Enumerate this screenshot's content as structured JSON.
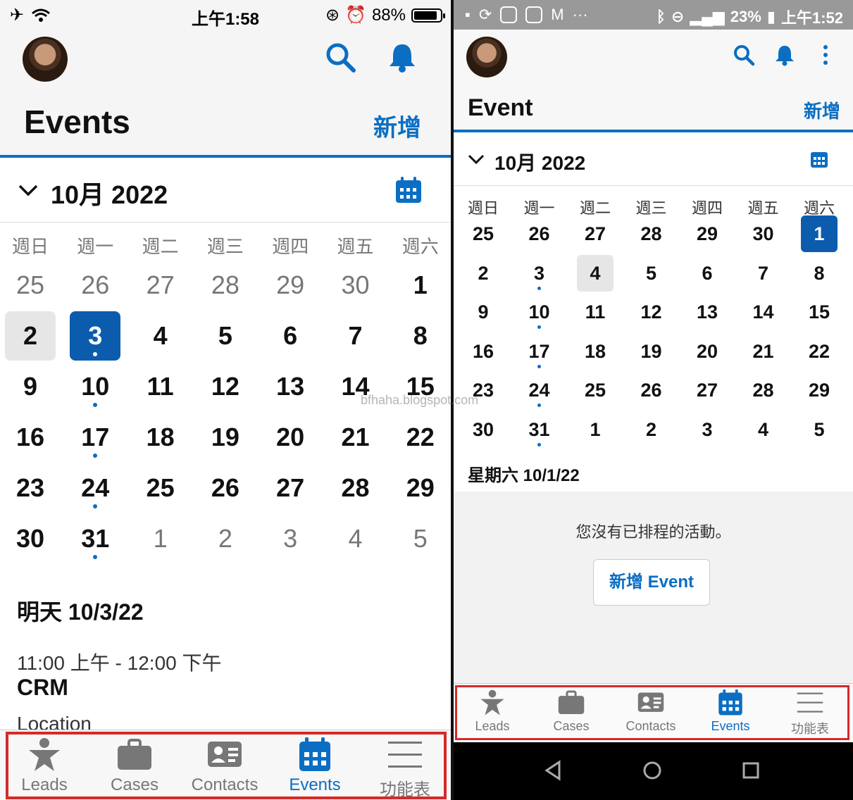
{
  "left": {
    "status": {
      "time": "上午1:58",
      "battery": "88%",
      "battery_level": 0.88
    },
    "title": "Events",
    "new_button": "新增",
    "month_label": "10月 2022",
    "weekdays": [
      "週日",
      "週一",
      "週二",
      "週三",
      "週四",
      "週五",
      "週六"
    ],
    "weeks": [
      [
        {
          "d": "25",
          "o": true
        },
        {
          "d": "26",
          "o": true
        },
        {
          "d": "27",
          "o": true
        },
        {
          "d": "28",
          "o": true
        },
        {
          "d": "29",
          "o": true
        },
        {
          "d": "30",
          "o": true
        },
        {
          "d": "1"
        }
      ],
      [
        {
          "d": "2",
          "today": true
        },
        {
          "d": "3",
          "sel": true,
          "dot": true
        },
        {
          "d": "4"
        },
        {
          "d": "5"
        },
        {
          "d": "6"
        },
        {
          "d": "7"
        },
        {
          "d": "8"
        }
      ],
      [
        {
          "d": "9"
        },
        {
          "d": "10",
          "dot": true
        },
        {
          "d": "11"
        },
        {
          "d": "12"
        },
        {
          "d": "13"
        },
        {
          "d": "14"
        },
        {
          "d": "15"
        }
      ],
      [
        {
          "d": "16"
        },
        {
          "d": "17",
          "dot": true
        },
        {
          "d": "18"
        },
        {
          "d": "19"
        },
        {
          "d": "20"
        },
        {
          "d": "21"
        },
        {
          "d": "22"
        }
      ],
      [
        {
          "d": "23"
        },
        {
          "d": "24",
          "dot": true
        },
        {
          "d": "25"
        },
        {
          "d": "26"
        },
        {
          "d": "27"
        },
        {
          "d": "28"
        },
        {
          "d": "29"
        }
      ],
      [
        {
          "d": "30"
        },
        {
          "d": "31",
          "dot": true
        },
        {
          "d": "1",
          "o": true
        },
        {
          "d": "2",
          "o": true
        },
        {
          "d": "3",
          "o": true
        },
        {
          "d": "4",
          "o": true
        },
        {
          "d": "5",
          "o": true
        }
      ]
    ],
    "day_heading": "明天 10/3/22",
    "event": {
      "time": "11:00 上午 - 12:00 下午",
      "name": "CRM",
      "location": "Location"
    },
    "tabs": [
      "Leads",
      "Cases",
      "Contacts",
      "Events",
      "功能表"
    ],
    "active_tab": "Events"
  },
  "right": {
    "status": {
      "time": "上午1:52",
      "battery": "23%"
    },
    "title": "Event",
    "new_button": "新增",
    "month_label": "10月 2022",
    "weekdays": [
      "週日",
      "週一",
      "週二",
      "週三",
      "週四",
      "週五",
      "週六"
    ],
    "weeks": [
      [
        {
          "d": "25"
        },
        {
          "d": "26"
        },
        {
          "d": "27"
        },
        {
          "d": "28"
        },
        {
          "d": "29"
        },
        {
          "d": "30"
        },
        {
          "d": "1",
          "sel": true
        }
      ],
      [
        {
          "d": "2"
        },
        {
          "d": "3",
          "dot": true
        },
        {
          "d": "4",
          "today": true
        },
        {
          "d": "5"
        },
        {
          "d": "6"
        },
        {
          "d": "7"
        },
        {
          "d": "8"
        }
      ],
      [
        {
          "d": "9"
        },
        {
          "d": "10",
          "dot": true
        },
        {
          "d": "11"
        },
        {
          "d": "12"
        },
        {
          "d": "13"
        },
        {
          "d": "14"
        },
        {
          "d": "15"
        }
      ],
      [
        {
          "d": "16"
        },
        {
          "d": "17",
          "dot": true
        },
        {
          "d": "18"
        },
        {
          "d": "19"
        },
        {
          "d": "20"
        },
        {
          "d": "21"
        },
        {
          "d": "22"
        }
      ],
      [
        {
          "d": "23"
        },
        {
          "d": "24",
          "dot": true
        },
        {
          "d": "25"
        },
        {
          "d": "26"
        },
        {
          "d": "27"
        },
        {
          "d": "28"
        },
        {
          "d": "29"
        }
      ],
      [
        {
          "d": "30"
        },
        {
          "d": "31",
          "dot": true
        },
        {
          "d": "1"
        },
        {
          "d": "2"
        },
        {
          "d": "3"
        },
        {
          "d": "4"
        },
        {
          "d": "5"
        }
      ]
    ],
    "day_heading": "星期六 10/1/22",
    "empty_message": "您沒有已排程的活動。",
    "add_event_button": "新增 Event",
    "tabs": [
      "Leads",
      "Cases",
      "Contacts",
      "Events",
      "功能表"
    ],
    "active_tab": "Events"
  },
  "watermark": "bfhaha.blogspot.com",
  "colors": {
    "accent": "#0b6ec3",
    "selected": "#0b5cad",
    "highlight_box": "#d42a2a"
  }
}
